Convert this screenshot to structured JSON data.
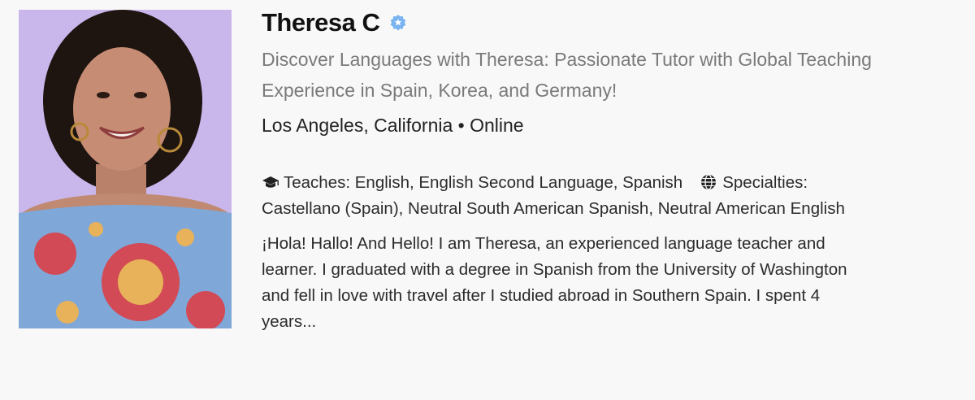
{
  "tutor": {
    "name": "Theresa C",
    "headline": "Discover Languages with Theresa: Passionate Tutor with Global Teaching Experience in Spain, Korea, and Germany!",
    "location": "Los Angeles, California • Online",
    "teaches_label": "Teaches: English, English Second Language, Spanish",
    "specialties_label": "Specialties: Castellano (Spain), Neutral South American Spanish, Neutral American English",
    "bio": "¡Hola! Hallo! And Hello! I am Theresa, an experienced language teacher and learner. I graduated with a degree in Spanish from the University of Washington and fell in love with travel after I studied abroad in Southern Spain. I spent 4 years..."
  },
  "icons": {
    "verified": "verified-badge-icon",
    "teaches": "graduation-cap-icon",
    "specialties": "globe-icon"
  },
  "colors": {
    "background": "#f8f8f8",
    "name": "#111111",
    "headline": "#7a7a7a",
    "body_text": "#2b2b2b",
    "verified_badge": "#7ab4f0"
  }
}
